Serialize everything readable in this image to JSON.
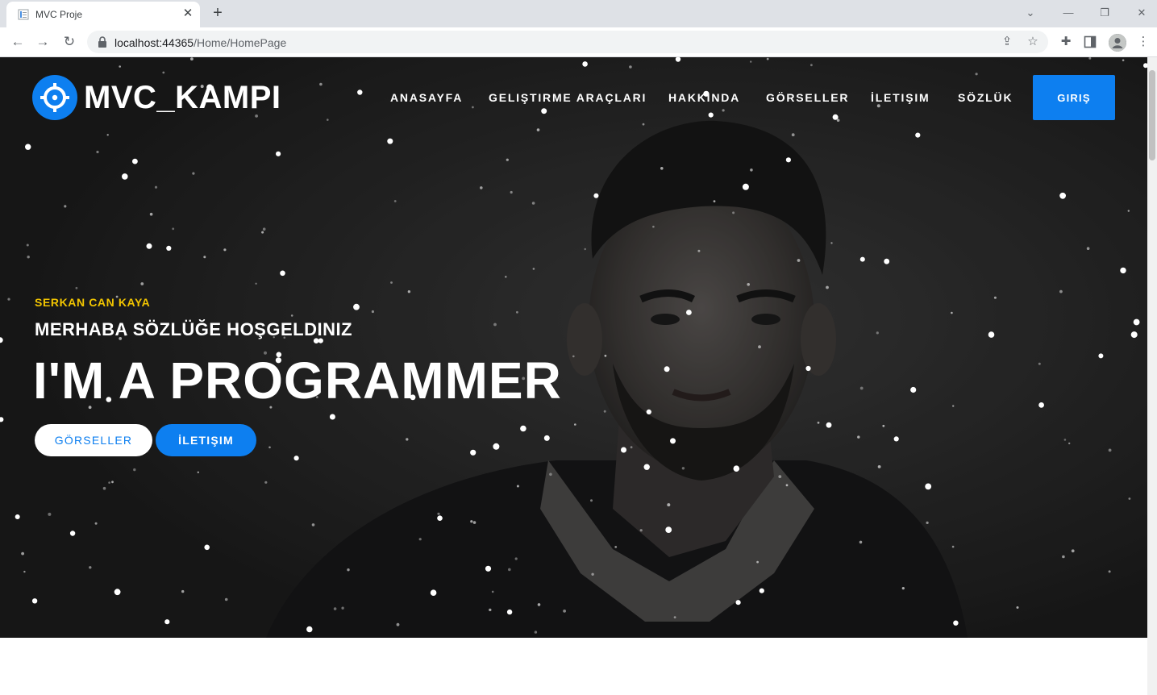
{
  "browser": {
    "tab_title": "MVC Proje",
    "tab_close": "✕",
    "new_tab": "+",
    "url_host": "localhost:44365",
    "url_path": "/Home/HomePage",
    "window_controls": {
      "dropdown": "⌄",
      "minimize": "—",
      "restore": "❐",
      "close": "✕"
    },
    "icons": [
      "back-arrow-icon",
      "forward-arrow-icon",
      "reload-icon",
      "lock-icon",
      "share-icon",
      "star-icon",
      "extensions-icon",
      "side-panel-icon",
      "profile-icon",
      "kebab-menu-icon"
    ]
  },
  "site": {
    "brand": "MVC_KAMPI",
    "nav": {
      "home": "ANASAYFA",
      "tools": "GELIŞTIRME ARAÇLARI",
      "about": "HAKKINDA",
      "images": "GÖRSELLER",
      "contact": "İLETIŞIM",
      "dictionary": "SÖZLÜK"
    },
    "login": "GIRIŞ"
  },
  "hero": {
    "eyebrow": "SERKAN CAN KAYA",
    "subtitle": "MERHABA SÖZLÜĞE HOŞGELDINIZ",
    "headline": "I'M A PROGRAMMER",
    "button_primary": "GÖRSELLER",
    "button_secondary": "İLETIŞIM"
  },
  "colors": {
    "accent": "#0d7ff0",
    "eyebrow": "#f2c500",
    "hero_bg": "#1f1f1f"
  }
}
